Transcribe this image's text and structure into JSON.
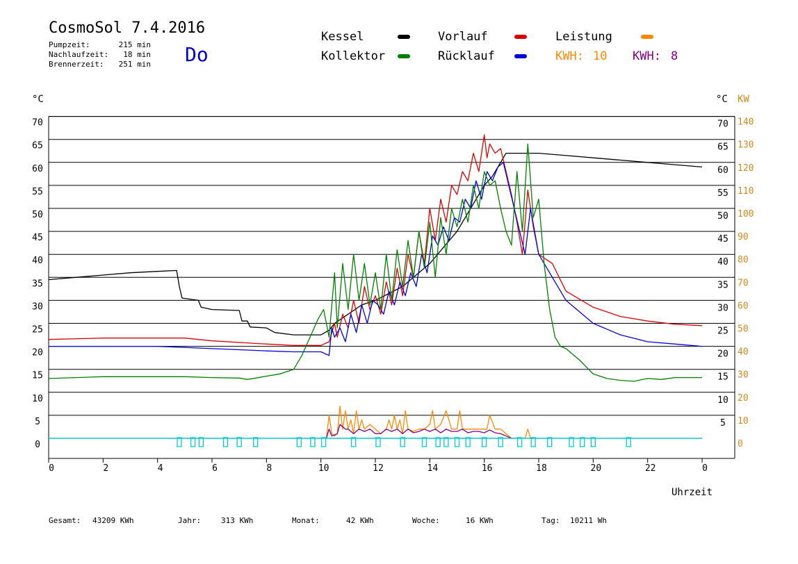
{
  "header": {
    "title": "CosmoSol 7.4.2016",
    "day": "Do",
    "stats": [
      {
        "label": "Pumpzeit:",
        "value": "215 min"
      },
      {
        "label": "Nachlaufzeit:",
        "value": "18 min"
      },
      {
        "label": "Brennerzeit:",
        "value": "251 min"
      }
    ]
  },
  "legend": {
    "items": [
      {
        "label": "Kessel",
        "color": "#000000"
      },
      {
        "label": "Vorlauf",
        "color": "#dd0000"
      },
      {
        "label": "Leistung",
        "color": "#ff8800"
      },
      {
        "label": "Kollektor",
        "color": "#008000"
      },
      {
        "label": "Rücklauf",
        "color": "#0000dd"
      }
    ],
    "kwh1": {
      "label": "KWH:",
      "value": "10",
      "color": "#ff8800"
    },
    "kwh2": {
      "label": "KWH:",
      "value": "8",
      "color": "#800080"
    }
  },
  "footer": {
    "gesamt": {
      "label": "Gesamt:",
      "value": "43209 KWh"
    },
    "jahr": {
      "label": "Jahr:",
      "value": "313 KWh"
    },
    "monat": {
      "label": "Monat:",
      "value": "42 KWh"
    },
    "woche": {
      "label": "Woche:",
      "value": "16 KWh"
    },
    "tag": {
      "label": "Tag:",
      "value": "10211 Wh"
    }
  },
  "chart_data": {
    "type": "line",
    "xlabel": "Uhrzeit",
    "ylabel_left": "°C",
    "ylabel_right_c": "°C",
    "ylabel_right_kw": "KW",
    "xlim": [
      0,
      24
    ],
    "ylim": [
      0,
      70
    ],
    "x_ticks": [
      "0",
      "2",
      "4",
      "6",
      "8",
      "10",
      "12",
      "14",
      "16",
      "18",
      "20",
      "22",
      "0"
    ],
    "y_ticks_left": [
      "0",
      "5",
      "10",
      "15",
      "20",
      "25",
      "30",
      "35",
      "40",
      "45",
      "50",
      "55",
      "60",
      "65",
      "70"
    ],
    "y_ticks_right_c": [
      "5",
      "10",
      "15",
      "20",
      "25",
      "30",
      "35",
      "40",
      "45",
      "50",
      "55",
      "60",
      "65",
      "70"
    ],
    "y_ticks_right_kw": [
      "0",
      "10",
      "20",
      "30",
      "40",
      "50",
      "60",
      "70",
      "80",
      "90",
      "100",
      "110",
      "120",
      "130",
      "140"
    ],
    "grid": "horizontal",
    "series": [
      {
        "name": "Kessel",
        "color": "#000000",
        "x": [
          0,
          1,
          2,
          3,
          4,
          4.7,
          4.8,
          4.9,
          5.5,
          5.6,
          6,
          7,
          7.1,
          7.3,
          7.4,
          8,
          8.3,
          9,
          10,
          10.3,
          10.5,
          11,
          11.5,
          12,
          13,
          14,
          15,
          15.5,
          16,
          16.3,
          16.6,
          16.8,
          17,
          18,
          19,
          20,
          21,
          22,
          23,
          24
        ],
        "y": [
          34.5,
          35,
          35.5,
          36,
          36.3,
          36.5,
          33,
          30.5,
          30,
          28.5,
          28,
          27.8,
          25.5,
          25.5,
          24.2,
          24,
          23,
          22.5,
          22.5,
          23.5,
          25,
          27,
          29,
          30,
          33,
          38,
          45,
          50,
          55,
          57,
          60,
          62,
          62,
          62,
          61.5,
          61,
          60.5,
          60,
          59.5,
          59
        ]
      },
      {
        "name": "Vorlauf",
        "color": "#dd0000",
        "x": [
          0,
          2,
          4,
          5,
          6,
          8,
          9,
          10,
          10.3,
          10.5,
          10.6,
          10.8,
          11,
          11.2,
          11.4,
          11.6,
          11.8,
          12,
          12.2,
          12.4,
          12.6,
          12.8,
          13,
          13.2,
          13.4,
          13.6,
          13.8,
          14,
          14.2,
          14.4,
          14.6,
          14.8,
          15,
          15.2,
          15.4,
          15.6,
          15.8,
          16,
          16.1,
          16.2,
          16.4,
          16.6,
          16.8,
          17,
          17.2,
          17.4,
          17.6,
          17.8,
          18,
          18.5,
          19,
          20,
          21,
          22,
          23,
          24
        ],
        "y": [
          21.5,
          21.8,
          21.8,
          21.8,
          21.2,
          20.5,
          20.2,
          20.2,
          21,
          25,
          22,
          27,
          24,
          30,
          25,
          33,
          28,
          31,
          27,
          34,
          29,
          37,
          31,
          40,
          35,
          45,
          38,
          50,
          43,
          52,
          47,
          55,
          53,
          58,
          56,
          62,
          58,
          66,
          61,
          64,
          62,
          63,
          58,
          53,
          47,
          40,
          54,
          46,
          40,
          38,
          32,
          28.5,
          26.5,
          25.5,
          24.8,
          24.5
        ]
      },
      {
        "name": "Rücklauf",
        "color": "#0000dd",
        "x": [
          0,
          2,
          4,
          6,
          8,
          9,
          10,
          10.3,
          10.4,
          10.5,
          10.7,
          10.9,
          11.1,
          11.3,
          11.5,
          11.7,
          11.9,
          12.1,
          12.3,
          12.5,
          12.7,
          12.9,
          13.1,
          13.3,
          13.5,
          13.7,
          13.9,
          14.1,
          14.3,
          14.5,
          14.7,
          14.9,
          15.1,
          15.3,
          15.5,
          15.7,
          15.9,
          16.1,
          16.3,
          16.5,
          16.7,
          16.9,
          17.1,
          17.3,
          17.5,
          17.7,
          18,
          18.5,
          19,
          20,
          21,
          22,
          23,
          24
        ],
        "y": [
          20,
          20,
          20,
          19.5,
          19,
          18.8,
          18.8,
          18,
          24,
          22,
          24,
          21,
          27,
          23,
          29,
          25,
          30,
          29,
          27,
          32,
          29,
          34,
          31,
          36,
          33,
          40,
          36,
          44,
          42,
          46,
          43,
          48,
          47,
          52,
          50,
          56,
          52,
          58,
          56,
          59,
          60,
          55,
          50,
          45,
          40,
          50,
          40,
          35,
          30,
          25,
          22.5,
          21,
          20.5,
          20
        ]
      },
      {
        "name": "Kollektor",
        "color": "#008000",
        "x": [
          0,
          1,
          2,
          3,
          4,
          5,
          6,
          7,
          7.3,
          8,
          8.5,
          9,
          9.3,
          9.6,
          9.9,
          10.1,
          10.3,
          10.5,
          10.6,
          10.8,
          11,
          11.2,
          11.4,
          11.6,
          11.8,
          12,
          12.2,
          12.4,
          12.6,
          12.8,
          13,
          13.2,
          13.4,
          13.6,
          13.8,
          14,
          14.2,
          14.4,
          14.6,
          14.8,
          15,
          15.2,
          15.4,
          15.6,
          15.8,
          16,
          16.2,
          16.4,
          16.6,
          16.8,
          17,
          17.2,
          17.4,
          17.6,
          17.8,
          18,
          18.2,
          18.4,
          18.6,
          18.8,
          19,
          19.5,
          20,
          20.5,
          21,
          21.5,
          22,
          22.5,
          23,
          24
        ],
        "y": [
          13,
          13.2,
          13.4,
          13.4,
          13.4,
          13.4,
          13.2,
          13.1,
          12.8,
          13.5,
          14,
          15,
          18,
          22,
          26,
          28,
          22,
          36,
          24,
          38,
          28,
          40,
          30,
          38,
          29,
          36,
          28,
          40,
          30,
          41,
          33,
          43,
          35,
          45,
          37,
          47,
          35,
          48,
          40,
          50,
          46,
          52,
          47,
          55,
          50,
          58,
          55,
          56,
          50,
          45,
          42,
          58,
          45,
          64,
          48,
          52,
          38,
          28,
          22,
          20,
          19.5,
          17,
          14,
          13,
          12.6,
          12.4,
          13,
          12.8,
          13.2,
          13.2
        ]
      },
      {
        "name": "Leistung",
        "color": "#ff8800",
        "x": [
          10.2,
          10.3,
          10.4,
          10.5,
          10.6,
          10.7,
          10.8,
          10.9,
          11,
          11.1,
          11.2,
          11.3,
          11.4,
          11.5,
          11.6,
          11.8,
          12,
          12.2,
          12.4,
          12.5,
          12.6,
          12.7,
          12.8,
          12.9,
          13,
          13.1,
          13.2,
          13.4,
          13.6,
          13.8,
          14,
          14.1,
          14.2,
          14.4,
          14.6,
          14.8,
          15,
          15.1,
          15.2,
          15.4,
          15.6,
          15.8,
          16,
          16.1,
          16.2,
          16.4,
          16.6,
          16.8,
          17,
          17.5,
          17.6,
          17.7,
          18
        ],
        "y": [
          0,
          5,
          1,
          0.5,
          1,
          7,
          2,
          6,
          2,
          4,
          1,
          6,
          2,
          4,
          2,
          3,
          2,
          1,
          2,
          4,
          2,
          5,
          2,
          4,
          1,
          6,
          2,
          1.5,
          2,
          2,
          3,
          6,
          2,
          3,
          6,
          2,
          2,
          6,
          2,
          2,
          2,
          2,
          2,
          2,
          5,
          2,
          2,
          1,
          0,
          0,
          2,
          0,
          0
        ]
      },
      {
        "name": "KWH8",
        "color": "#800080",
        "x": [
          10.2,
          10.3,
          10.4,
          10.6,
          10.7,
          10.9,
          11,
          11.2,
          11.4,
          11.6,
          11.8,
          12,
          12.2,
          12.4,
          12.6,
          12.8,
          13,
          13.2,
          13.4,
          13.6,
          13.8,
          14,
          14.2,
          14.4,
          14.6,
          14.8,
          15,
          15.2,
          15.4,
          15.6,
          15.8,
          16,
          16.2,
          16.4,
          16.6,
          16.8,
          17
        ],
        "y": [
          0,
          2,
          0.5,
          1,
          3,
          2,
          2,
          1,
          2,
          1.5,
          2,
          1,
          1,
          2,
          1.5,
          2,
          1,
          2,
          1.2,
          1.5,
          2,
          1.5,
          2,
          1.2,
          2,
          1.5,
          1.5,
          2,
          1.2,
          1.5,
          1.5,
          1.2,
          1.8,
          1.2,
          1,
          0.5,
          0
        ]
      }
    ],
    "markers": {
      "color": "#00cccc",
      "baseline": 0,
      "x": [
        4.8,
        5.3,
        5.6,
        6.5,
        7,
        7.6,
        9.2,
        9.7,
        10.1,
        11.2,
        12.1,
        13.0,
        13.8,
        14.3,
        14.6,
        15.0,
        15.4,
        16.0,
        16.6,
        17.3,
        17.8,
        18.4,
        19.2,
        19.6,
        20.0,
        21.3
      ]
    }
  }
}
